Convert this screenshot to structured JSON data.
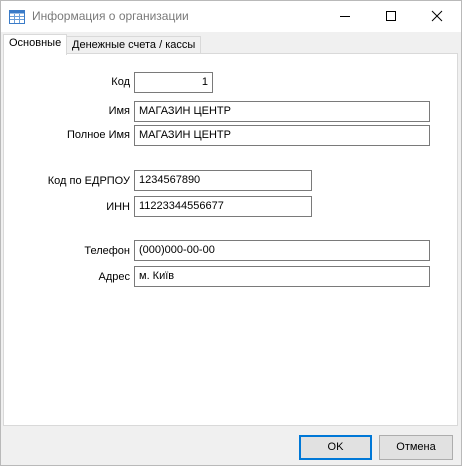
{
  "window": {
    "title": "Информация о организации"
  },
  "tabs": [
    {
      "label": "Основные",
      "active": true
    },
    {
      "label": "Денежные счета / кассы",
      "active": false
    }
  ],
  "form": {
    "code": {
      "label": "Код",
      "value": "1"
    },
    "name": {
      "label": "Имя",
      "value": "МАГАЗИН ЦЕНТР"
    },
    "full_name": {
      "label": "Полное Имя",
      "value": "МАГАЗИН ЦЕНТР"
    },
    "edrpou": {
      "label": "Код по ЕДРПОУ",
      "value": "1234567890"
    },
    "inn": {
      "label": "ИНН",
      "value": "11223344556677"
    },
    "phone": {
      "label": "Телефон",
      "value": "(000)000-00-00"
    },
    "address": {
      "label": "Адрес",
      "value": "м. Київ"
    }
  },
  "buttons": {
    "ok": "OK",
    "cancel": "Отмена"
  },
  "icons": {
    "app": "table-window-icon",
    "minimize": "minimize-icon",
    "maximize": "maximize-icon",
    "close": "close-icon"
  },
  "colors": {
    "accent": "#0078d7",
    "window_bg": "#f0f0f0",
    "title_text": "#7a7a7a"
  }
}
